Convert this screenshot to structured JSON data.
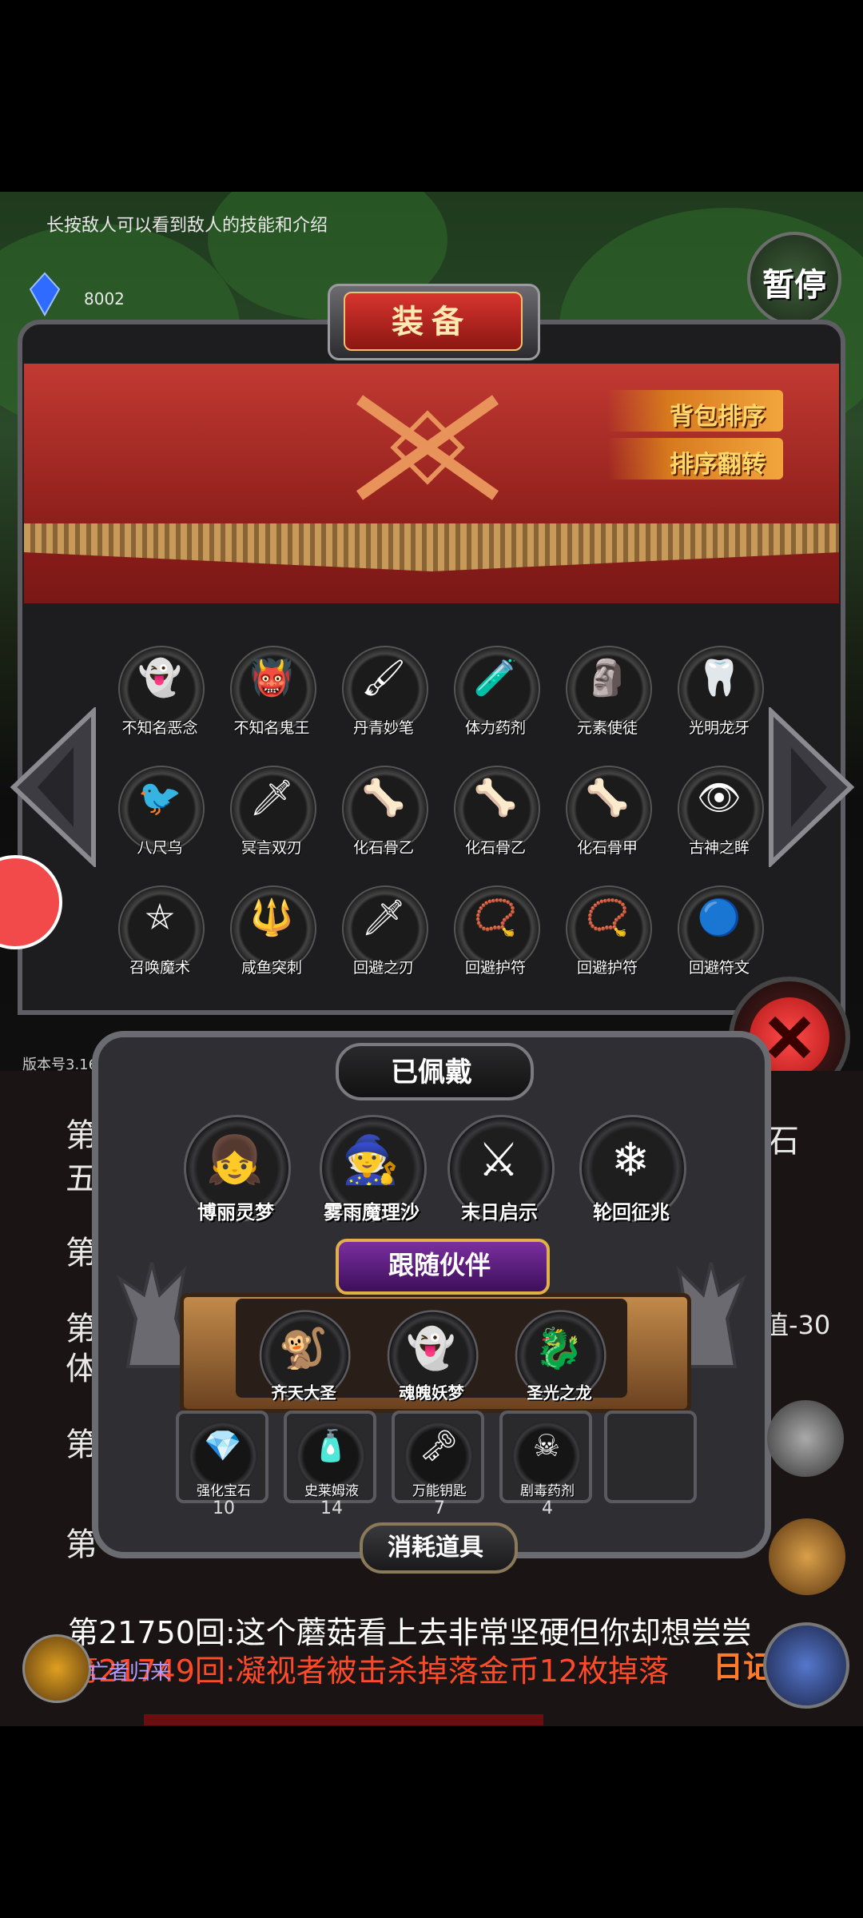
{
  "hint": "长按敌人可以看到敌人的技能和介绍",
  "gem": {
    "icon": "gem-icon",
    "count": "8002"
  },
  "pause_label": "暂停",
  "equip": {
    "title": "装备",
    "sort_label": "背包排序",
    "reverse_label": "排序翻转",
    "items": [
      {
        "label": "不知名恶念",
        "glyph": "👻"
      },
      {
        "label": "不知名鬼王",
        "glyph": "👹"
      },
      {
        "label": "丹青妙笔",
        "glyph": "🖌"
      },
      {
        "label": "体力药剂",
        "glyph": "🧪"
      },
      {
        "label": "元素使徒",
        "glyph": "🗿"
      },
      {
        "label": "光明龙牙",
        "glyph": "🦷"
      },
      {
        "label": "八尺乌",
        "glyph": "🐦"
      },
      {
        "label": "冥言双刃",
        "glyph": "🗡"
      },
      {
        "label": "化石骨乙",
        "glyph": "🦴"
      },
      {
        "label": "化石骨乙",
        "glyph": "🦴"
      },
      {
        "label": "化石骨甲",
        "glyph": "🦴"
      },
      {
        "label": "古神之眸",
        "glyph": "👁"
      },
      {
        "label": "召唤魔术",
        "glyph": "⛤"
      },
      {
        "label": "咸鱼突刺",
        "glyph": "🔱"
      },
      {
        "label": "回避之刃",
        "glyph": "🗡"
      },
      {
        "label": "回避护符",
        "glyph": "📿"
      },
      {
        "label": "回避护符",
        "glyph": "📿"
      },
      {
        "label": "回避符文",
        "glyph": "🔵"
      }
    ]
  },
  "version": "版本号3.16",
  "worn": {
    "title": "已佩戴",
    "items": [
      {
        "label": "博丽灵梦",
        "glyph": "👧"
      },
      {
        "label": "雾雨魔理沙",
        "glyph": "🧙"
      },
      {
        "label": "末日启示",
        "glyph": "⚔"
      },
      {
        "label": "轮回征兆",
        "glyph": "❄"
      }
    ]
  },
  "companions": {
    "title": "跟随伙伴",
    "items": [
      {
        "label": "齐天大圣",
        "glyph": "🐒"
      },
      {
        "label": "魂魄妖梦",
        "glyph": "👻"
      },
      {
        "label": "圣光之龙",
        "glyph": "🐉"
      }
    ]
  },
  "consumables": {
    "title": "消耗道具",
    "items": [
      {
        "label": "强化宝石",
        "glyph": "💎",
        "count": "10"
      },
      {
        "label": "史莱姆液",
        "glyph": "🧴",
        "count": "14"
      },
      {
        "label": "万能钥匙",
        "glyph": "🗝",
        "count": "7"
      },
      {
        "label": "剧毒药剂",
        "glyph": "☠",
        "count": "4"
      }
    ]
  },
  "log": {
    "line1": "第21750回:这个蘑菇看上去非常坚硬但你却想尝尝",
    "line2": "第21749回:凝视者被击杀掉落金币12枚掉落",
    "frag_a": "第",
    "frag_b": "五",
    "frag_c": "石",
    "frag_d": "值-30",
    "frag_e": "体"
  },
  "player_name": "亡者归来",
  "diary_label": "日记"
}
